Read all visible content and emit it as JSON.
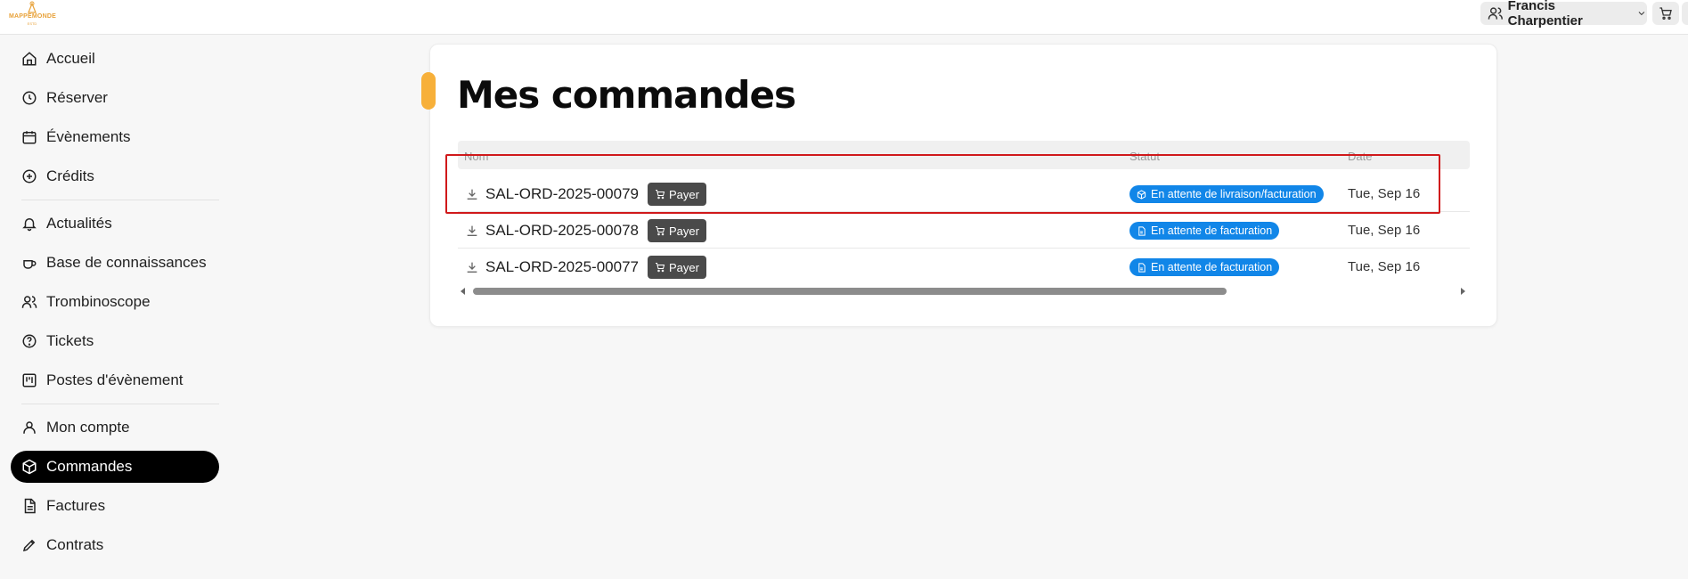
{
  "brand": {
    "name": "MAPPEMONDE",
    "sub": "ESTD"
  },
  "header": {
    "user_name": "Francis Charpentier"
  },
  "sidebar": {
    "items": [
      {
        "label": "Accueil",
        "icon": "home-icon"
      },
      {
        "label": "Réserver",
        "icon": "clock-icon"
      },
      {
        "label": "Évènements",
        "icon": "calendar-icon"
      },
      {
        "label": "Crédits",
        "icon": "plus-circle-icon"
      },
      {
        "label": "Actualités",
        "icon": "bell-icon"
      },
      {
        "label": "Base de connaissances",
        "icon": "coffee-icon"
      },
      {
        "label": "Trombinoscope",
        "icon": "users-icon"
      },
      {
        "label": "Tickets",
        "icon": "help-circle-icon"
      },
      {
        "label": "Postes d'évènement",
        "icon": "kanban-icon"
      },
      {
        "label": "Mon compte",
        "icon": "user-icon"
      },
      {
        "label": "Commandes",
        "icon": "package-icon",
        "active": true
      },
      {
        "label": "Factures",
        "icon": "file-text-icon"
      },
      {
        "label": "Contrats",
        "icon": "pen-icon"
      }
    ]
  },
  "main": {
    "title": "Mes commandes",
    "columns": {
      "name": "Nom",
      "status": "Statut",
      "date": "Date"
    },
    "rows": [
      {
        "order": "SAL-ORD-2025-00079",
        "pay_label": "Payer",
        "status": "En attente de livraison/facturation",
        "status_icon": "package-icon",
        "date": "Tue, Sep 16"
      },
      {
        "order": "SAL-ORD-2025-00078",
        "pay_label": "Payer",
        "status": "En attente de facturation",
        "status_icon": "file-icon",
        "date": "Tue, Sep 16"
      },
      {
        "order": "SAL-ORD-2025-00077",
        "pay_label": "Payer",
        "status": "En attente de facturation",
        "status_icon": "file-icon",
        "date": "Tue, Sep 16"
      }
    ]
  },
  "colors": {
    "accent": "#f7b03a",
    "status_blue": "#1186e8",
    "highlight": "#d0191b",
    "active_nav": "#000000"
  }
}
